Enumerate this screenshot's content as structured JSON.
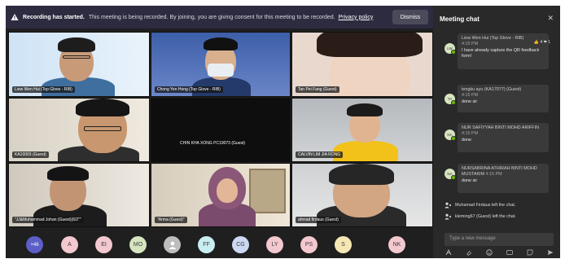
{
  "banner": {
    "title": "Recording has started.",
    "message": "This meeting is being recorded. By joining, you are giving consent for this meeting to be recorded.",
    "link": "Privacy policy",
    "dismiss_label": "Dismiss"
  },
  "tiles": [
    {
      "label": "Liew Wen Hui (Top Glove - RIB)"
    },
    {
      "label": "Chong Yen Hong (Top Glove - RIB)"
    },
    {
      "label": "Tan Pei Fang (Guest)"
    },
    {
      "label": "KA10003 (Guest)"
    },
    {
      "label": "CHIN KHA XONG PC19073 (Guest)"
    },
    {
      "label": "CALVIN LIM JIA RONG"
    },
    {
      "label": "\"JJ&Muhammad Johan (Guest)(6/2\"\""
    },
    {
      "label": "\"Arma (Guest)\""
    },
    {
      "label": "ahmad firdaus (Guest)"
    }
  ],
  "avatars": [
    {
      "initials": "+46",
      "color": "#5b5fc7"
    },
    {
      "initials": "A",
      "color": "#f3c8cf"
    },
    {
      "initials": "EI",
      "color": "#f3c8cf"
    },
    {
      "initials": "MO",
      "color": "#d6e4c0"
    },
    {
      "initials": "",
      "color": "#bdbdbd"
    },
    {
      "initials": "FF",
      "color": "#c9eef2"
    },
    {
      "initials": "CG",
      "color": "#cdd8f3"
    },
    {
      "initials": "LY",
      "color": "#f3c8cf"
    },
    {
      "initials": "PS",
      "color": "#f3c8cf"
    },
    {
      "initials": "S",
      "color": "#f6e7b4"
    },
    {
      "initials": "NK",
      "color": "#f3c8cf"
    }
  ],
  "chat": {
    "title": "Meeting chat",
    "messages": [
      {
        "avatar": "LW",
        "name": "Liew Wen Hui (Top Glove - RIB)",
        "time": "4:15 PM",
        "text": "I have already capture the QR feedback form!",
        "reactions": "👍 4  ❤ 1"
      },
      {
        "avatar": "TA",
        "name": "tengku ayu (KA17077) (Guest)",
        "time": "4:15 PM",
        "text": "done sir"
      },
      {
        "avatar": "NA",
        "name": "NUR SAFIYYAH BINTI MOHD ARIFFIN",
        "time": "4:15 PM",
        "text": "done"
      },
      {
        "avatar": "NA",
        "name": "NURSABRINA ATHIRAH BINTI MOHD MUSTAKIM",
        "time": "4:15 PM",
        "text": "done sir"
      }
    ],
    "system": [
      {
        "text": "Muhamad Firdaus left the chat."
      },
      {
        "text": "kleming67 (Guest) left the chat."
      }
    ],
    "input_placeholder": "Type a new message"
  }
}
